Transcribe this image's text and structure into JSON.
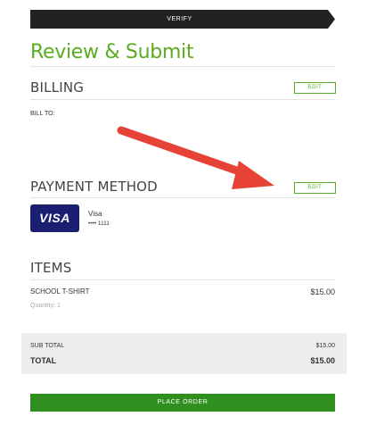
{
  "step": {
    "label": "VERIFY"
  },
  "page": {
    "title": "Review & Submit"
  },
  "billing": {
    "title": "BILLING",
    "edit_label": "EDIT",
    "bill_to": "BILL TO:"
  },
  "payment": {
    "title": "PAYMENT METHOD",
    "edit_label": "EDIT",
    "card_logo": "VISA",
    "card_brand": "Visa",
    "card_number": "•••• 1111"
  },
  "items": {
    "title": "ITEMS",
    "list": [
      {
        "name": "SCHOOL T-SHIRT",
        "quantity": "Quantity: 1",
        "price": "$15.00"
      }
    ]
  },
  "totals": {
    "subtotal_label": "SUB TOTAL",
    "subtotal_value": "$15.00",
    "total_label": "TOTAL",
    "total_value": "$15.00"
  },
  "place_order_label": "PLACE ORDER",
  "colors": {
    "accent_green": "#5aab22",
    "button_green": "#2f8f1f",
    "step_bar": "#222222",
    "annotation_red": "#e64336",
    "visa_blue": "#1a1f71"
  },
  "icons": {
    "annotation": "arrow-annotation-icon"
  }
}
